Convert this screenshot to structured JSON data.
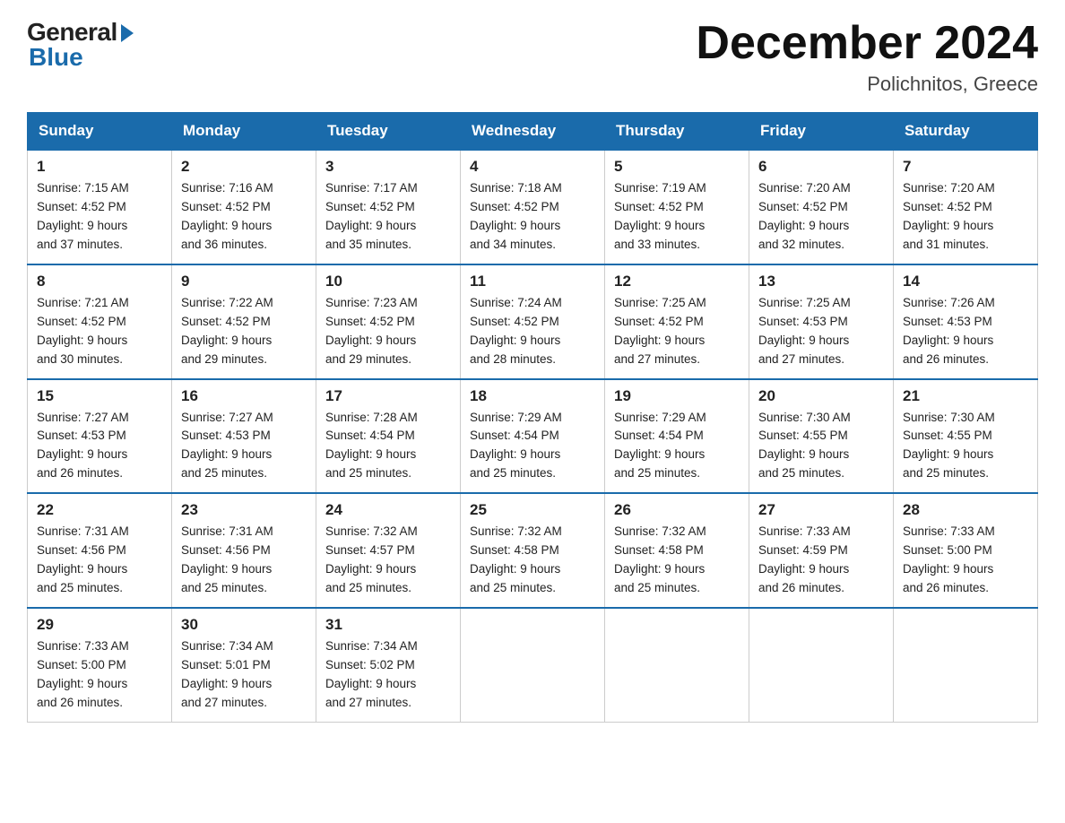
{
  "logo": {
    "general": "General",
    "blue": "Blue"
  },
  "header": {
    "month": "December 2024",
    "location": "Polichnitos, Greece"
  },
  "weekdays": [
    "Sunday",
    "Monday",
    "Tuesday",
    "Wednesday",
    "Thursday",
    "Friday",
    "Saturday"
  ],
  "weeks": [
    [
      {
        "day": "1",
        "sunrise": "7:15 AM",
        "sunset": "4:52 PM",
        "daylight": "9 hours and 37 minutes."
      },
      {
        "day": "2",
        "sunrise": "7:16 AM",
        "sunset": "4:52 PM",
        "daylight": "9 hours and 36 minutes."
      },
      {
        "day": "3",
        "sunrise": "7:17 AM",
        "sunset": "4:52 PM",
        "daylight": "9 hours and 35 minutes."
      },
      {
        "day": "4",
        "sunrise": "7:18 AM",
        "sunset": "4:52 PM",
        "daylight": "9 hours and 34 minutes."
      },
      {
        "day": "5",
        "sunrise": "7:19 AM",
        "sunset": "4:52 PM",
        "daylight": "9 hours and 33 minutes."
      },
      {
        "day": "6",
        "sunrise": "7:20 AM",
        "sunset": "4:52 PM",
        "daylight": "9 hours and 32 minutes."
      },
      {
        "day": "7",
        "sunrise": "7:20 AM",
        "sunset": "4:52 PM",
        "daylight": "9 hours and 31 minutes."
      }
    ],
    [
      {
        "day": "8",
        "sunrise": "7:21 AM",
        "sunset": "4:52 PM",
        "daylight": "9 hours and 30 minutes."
      },
      {
        "day": "9",
        "sunrise": "7:22 AM",
        "sunset": "4:52 PM",
        "daylight": "9 hours and 29 minutes."
      },
      {
        "day": "10",
        "sunrise": "7:23 AM",
        "sunset": "4:52 PM",
        "daylight": "9 hours and 29 minutes."
      },
      {
        "day": "11",
        "sunrise": "7:24 AM",
        "sunset": "4:52 PM",
        "daylight": "9 hours and 28 minutes."
      },
      {
        "day": "12",
        "sunrise": "7:25 AM",
        "sunset": "4:52 PM",
        "daylight": "9 hours and 27 minutes."
      },
      {
        "day": "13",
        "sunrise": "7:25 AM",
        "sunset": "4:53 PM",
        "daylight": "9 hours and 27 minutes."
      },
      {
        "day": "14",
        "sunrise": "7:26 AM",
        "sunset": "4:53 PM",
        "daylight": "9 hours and 26 minutes."
      }
    ],
    [
      {
        "day": "15",
        "sunrise": "7:27 AM",
        "sunset": "4:53 PM",
        "daylight": "9 hours and 26 minutes."
      },
      {
        "day": "16",
        "sunrise": "7:27 AM",
        "sunset": "4:53 PM",
        "daylight": "9 hours and 25 minutes."
      },
      {
        "day": "17",
        "sunrise": "7:28 AM",
        "sunset": "4:54 PM",
        "daylight": "9 hours and 25 minutes."
      },
      {
        "day": "18",
        "sunrise": "7:29 AM",
        "sunset": "4:54 PM",
        "daylight": "9 hours and 25 minutes."
      },
      {
        "day": "19",
        "sunrise": "7:29 AM",
        "sunset": "4:54 PM",
        "daylight": "9 hours and 25 minutes."
      },
      {
        "day": "20",
        "sunrise": "7:30 AM",
        "sunset": "4:55 PM",
        "daylight": "9 hours and 25 minutes."
      },
      {
        "day": "21",
        "sunrise": "7:30 AM",
        "sunset": "4:55 PM",
        "daylight": "9 hours and 25 minutes."
      }
    ],
    [
      {
        "day": "22",
        "sunrise": "7:31 AM",
        "sunset": "4:56 PM",
        "daylight": "9 hours and 25 minutes."
      },
      {
        "day": "23",
        "sunrise": "7:31 AM",
        "sunset": "4:56 PM",
        "daylight": "9 hours and 25 minutes."
      },
      {
        "day": "24",
        "sunrise": "7:32 AM",
        "sunset": "4:57 PM",
        "daylight": "9 hours and 25 minutes."
      },
      {
        "day": "25",
        "sunrise": "7:32 AM",
        "sunset": "4:58 PM",
        "daylight": "9 hours and 25 minutes."
      },
      {
        "day": "26",
        "sunrise": "7:32 AM",
        "sunset": "4:58 PM",
        "daylight": "9 hours and 25 minutes."
      },
      {
        "day": "27",
        "sunrise": "7:33 AM",
        "sunset": "4:59 PM",
        "daylight": "9 hours and 26 minutes."
      },
      {
        "day": "28",
        "sunrise": "7:33 AM",
        "sunset": "5:00 PM",
        "daylight": "9 hours and 26 minutes."
      }
    ],
    [
      {
        "day": "29",
        "sunrise": "7:33 AM",
        "sunset": "5:00 PM",
        "daylight": "9 hours and 26 minutes."
      },
      {
        "day": "30",
        "sunrise": "7:34 AM",
        "sunset": "5:01 PM",
        "daylight": "9 hours and 27 minutes."
      },
      {
        "day": "31",
        "sunrise": "7:34 AM",
        "sunset": "5:02 PM",
        "daylight": "9 hours and 27 minutes."
      },
      null,
      null,
      null,
      null
    ]
  ],
  "labels": {
    "sunrise": "Sunrise:",
    "sunset": "Sunset:",
    "daylight": "Daylight:"
  }
}
